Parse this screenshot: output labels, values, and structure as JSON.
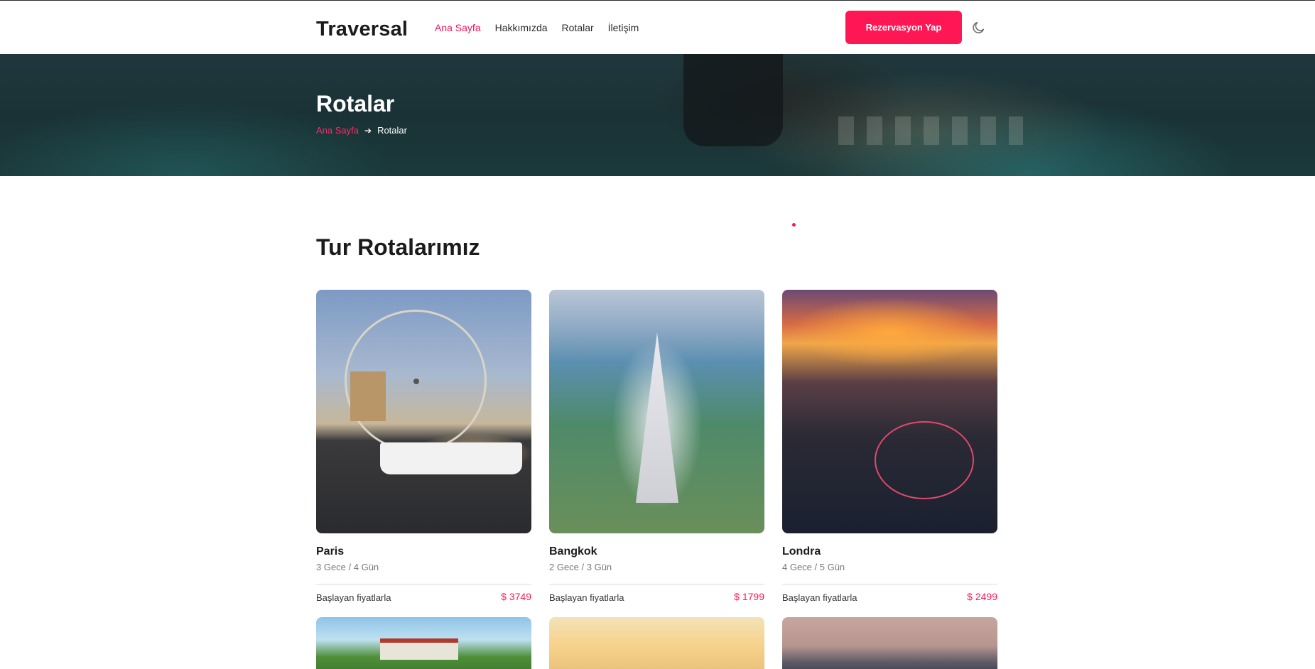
{
  "header": {
    "brand": "Traversal",
    "nav": [
      {
        "label": "Ana Sayfa",
        "active": true
      },
      {
        "label": "Hakkımızda",
        "active": false
      },
      {
        "label": "Rotalar",
        "active": false
      },
      {
        "label": "İletişim",
        "active": false
      }
    ],
    "reserve_label": "Rezervasyon Yap",
    "theme_icon": "moon-icon"
  },
  "hero": {
    "title": "Rotalar",
    "breadcrumb": {
      "home": "Ana Sayfa",
      "current": "Rotalar"
    }
  },
  "section": {
    "title": "Tur Rotalarımız"
  },
  "tours": [
    {
      "name": "Paris",
      "duration": "3 Gece / 4 Gün",
      "from_label": "Başlayan fiyatlarla",
      "price": "$ 3749"
    },
    {
      "name": "Bangkok",
      "duration": "2 Gece / 3 Gün",
      "from_label": "Başlayan fiyatlarla",
      "price": "$ 1799"
    },
    {
      "name": "Londra",
      "duration": "4 Gece / 5 Gün",
      "from_label": "Başlayan fiyatlarla",
      "price": "$ 2499"
    }
  ],
  "colors": {
    "accent": "#ff1654",
    "text": "#1b1b1b",
    "muted": "#777777"
  }
}
